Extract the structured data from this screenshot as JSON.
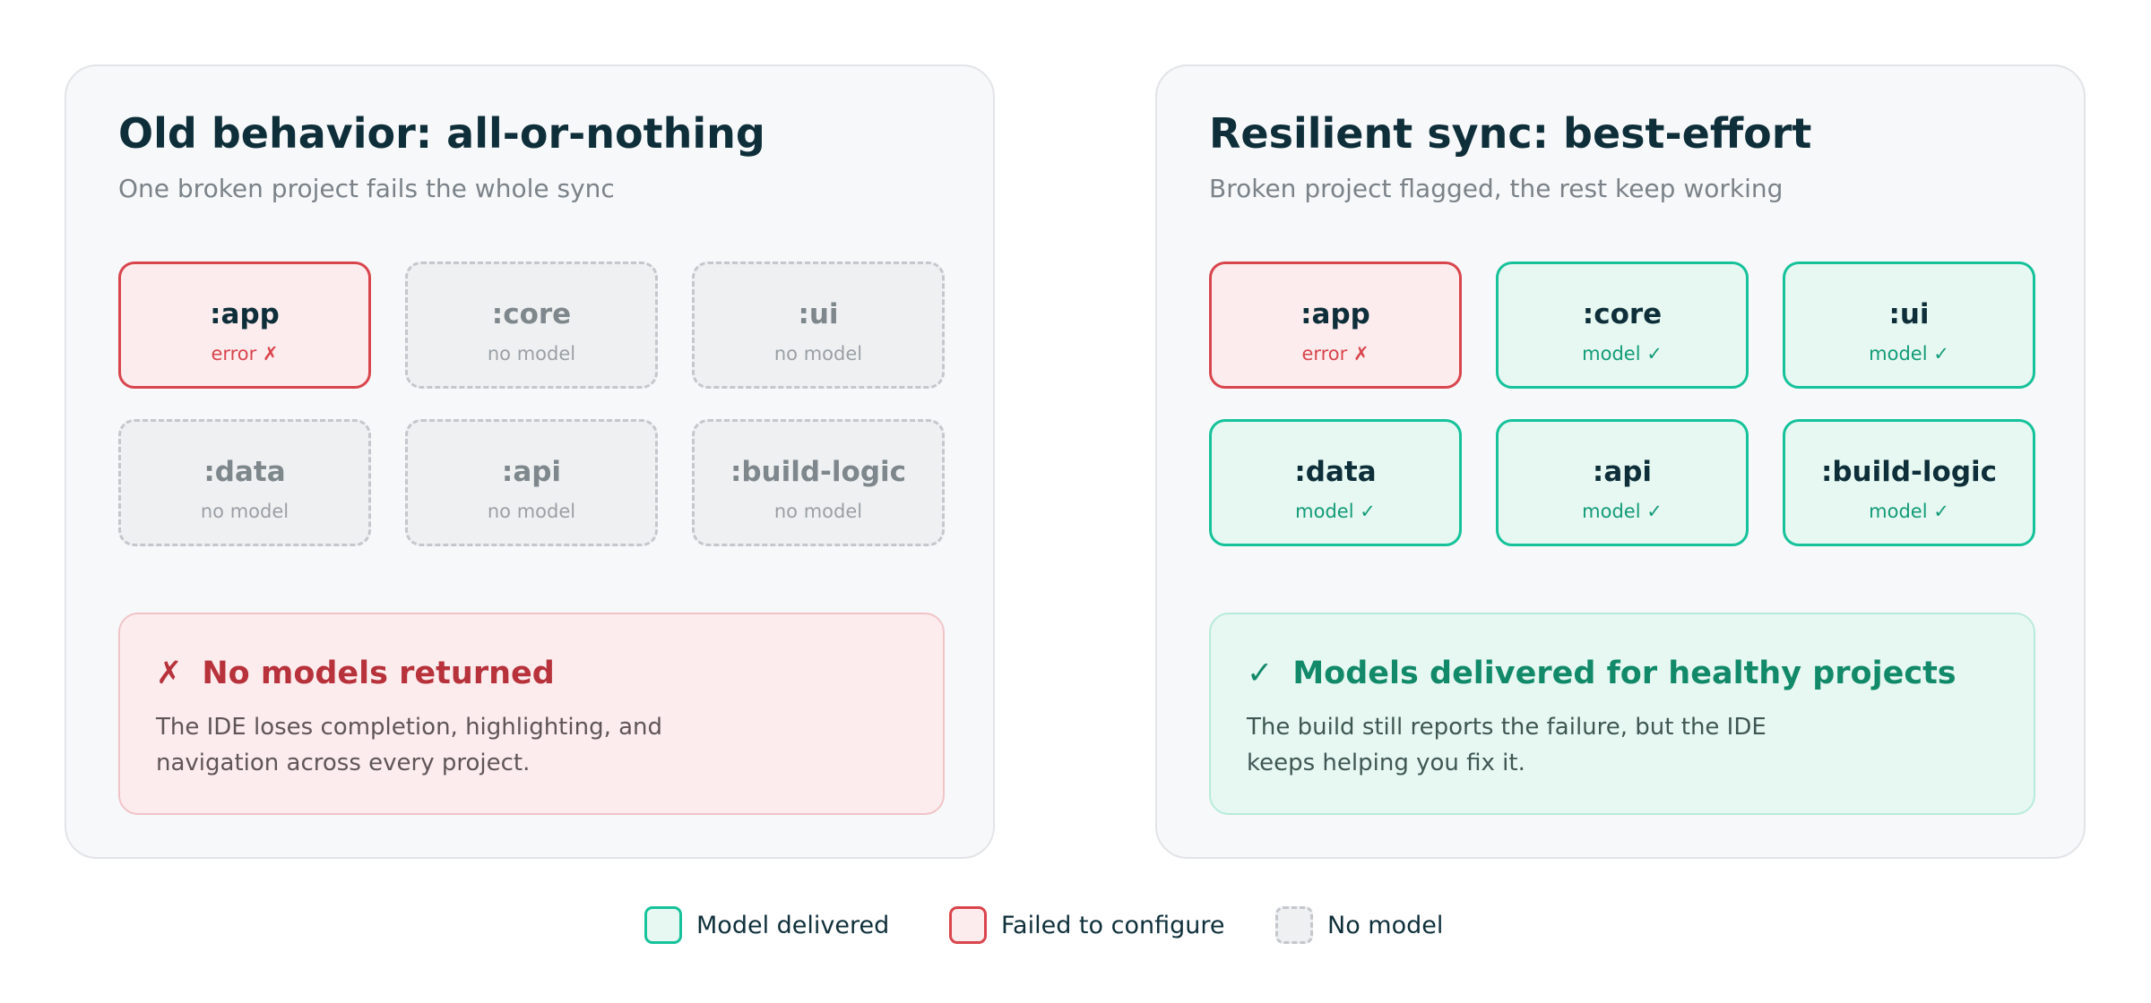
{
  "left_panel": {
    "title": "Old behavior: all-or-nothing",
    "subtitle": "One broken project fails the whole sync",
    "projects": [
      {
        "name": ":app",
        "status": "error ✗",
        "state": "failed"
      },
      {
        "name": ":core",
        "status": "no model",
        "state": "no-model"
      },
      {
        "name": ":ui",
        "status": "no model",
        "state": "no-model"
      },
      {
        "name": ":data",
        "status": "no model",
        "state": "no-model"
      },
      {
        "name": ":api",
        "status": "no model",
        "state": "no-model"
      },
      {
        "name": ":build-logic",
        "status": "no model",
        "state": "no-model"
      }
    ],
    "result": {
      "mark": "✗",
      "heading": "No models returned",
      "body_lines": [
        "The IDE loses completion, highlighting, and",
        "navigation across every project."
      ]
    }
  },
  "right_panel": {
    "title": "Resilient sync: best-effort",
    "subtitle": "Broken project flagged, the rest keep working",
    "projects": [
      {
        "name": ":app",
        "status": "error ✗",
        "state": "failed"
      },
      {
        "name": ":core",
        "status": "model ✓",
        "state": "delivered"
      },
      {
        "name": ":ui",
        "status": "model ✓",
        "state": "delivered"
      },
      {
        "name": ":data",
        "status": "model ✓",
        "state": "delivered"
      },
      {
        "name": ":api",
        "status": "model ✓",
        "state": "delivered"
      },
      {
        "name": ":build-logic",
        "status": "model ✓",
        "state": "delivered"
      }
    ],
    "result": {
      "mark": "✓",
      "heading": "Models delivered for healthy projects",
      "body_lines": [
        "The build still reports the failure, but the IDE",
        "keeps helping you fix it."
      ]
    }
  },
  "legend": [
    {
      "label": "Model delivered",
      "state": "delivered"
    },
    {
      "label": "Failed to configure",
      "state": "failed"
    },
    {
      "label": "No model",
      "state": "no-model"
    }
  ],
  "colors": {
    "delivered_border": "#15c29a",
    "delivered_fill": "#e6f8f1",
    "failed_border": "#d9454d",
    "failed_fill": "#fdeced",
    "no_model_border": "#c4c7cb",
    "no_model_fill": "#eff0f2",
    "title_text": "#0e2f3a"
  }
}
